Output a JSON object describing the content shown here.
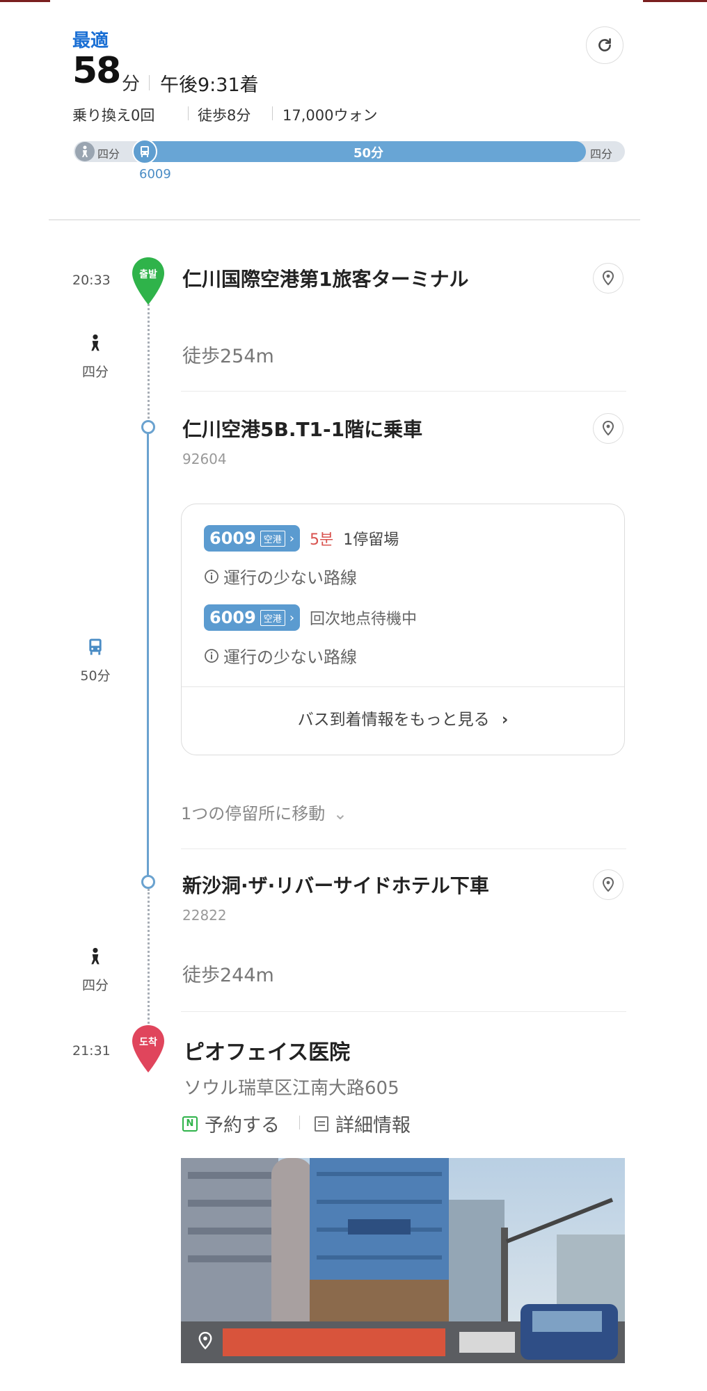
{
  "summary": {
    "badge": "最適",
    "total_time": "58",
    "total_unit": "分",
    "arrival": "午後9:31着",
    "transfers": "乗り換え0回",
    "walk": "徒歩8分",
    "fare": "17,000ウォン",
    "bar": {
      "walk_start": "四分",
      "bus_duration": "50分",
      "walk_end": "四分",
      "route": "6009"
    }
  },
  "timeline": {
    "depart": {
      "time": "20:33",
      "pin_label": "출발",
      "name": "仁川国際空港第1旅客ターミナル"
    },
    "walk1": {
      "side_label": "四分",
      "text": "徒歩254m"
    },
    "board": {
      "name": "仁川空港5B.T1-1階に乗車",
      "stop_id": "92604"
    },
    "bus_side_label": "50分",
    "arrivals": [
      {
        "route": "6009",
        "tag": "空港",
        "eta": "5분",
        "detail": "1停留場",
        "note": "運行の少ない路線"
      },
      {
        "route": "6009",
        "tag": "空港",
        "eta": "",
        "detail": "回次地点待機中",
        "note": "運行の少ない路線"
      }
    ],
    "more_label": "バス到着情報をもっと見る",
    "move_label": "1つの停留所に移動",
    "alight": {
      "name": "新沙洞·ザ·リバーサイドホテル下車",
      "stop_id": "22822"
    },
    "walk2": {
      "side_label": "四分",
      "text": "徒歩244m"
    },
    "arrive": {
      "time": "21:31",
      "pin_label": "도착",
      "name": "ピオフェイス医院",
      "address": "ソウル瑞草区江南大路605",
      "reserve": "予約する",
      "details": "詳細情報"
    }
  },
  "colors": {
    "accent": "#1a6fd4",
    "bus": "#5b9bd0",
    "depart_pin": "#2fb34a",
    "arrive_pin": "#e0455c",
    "eta_red": "#d9534f"
  }
}
